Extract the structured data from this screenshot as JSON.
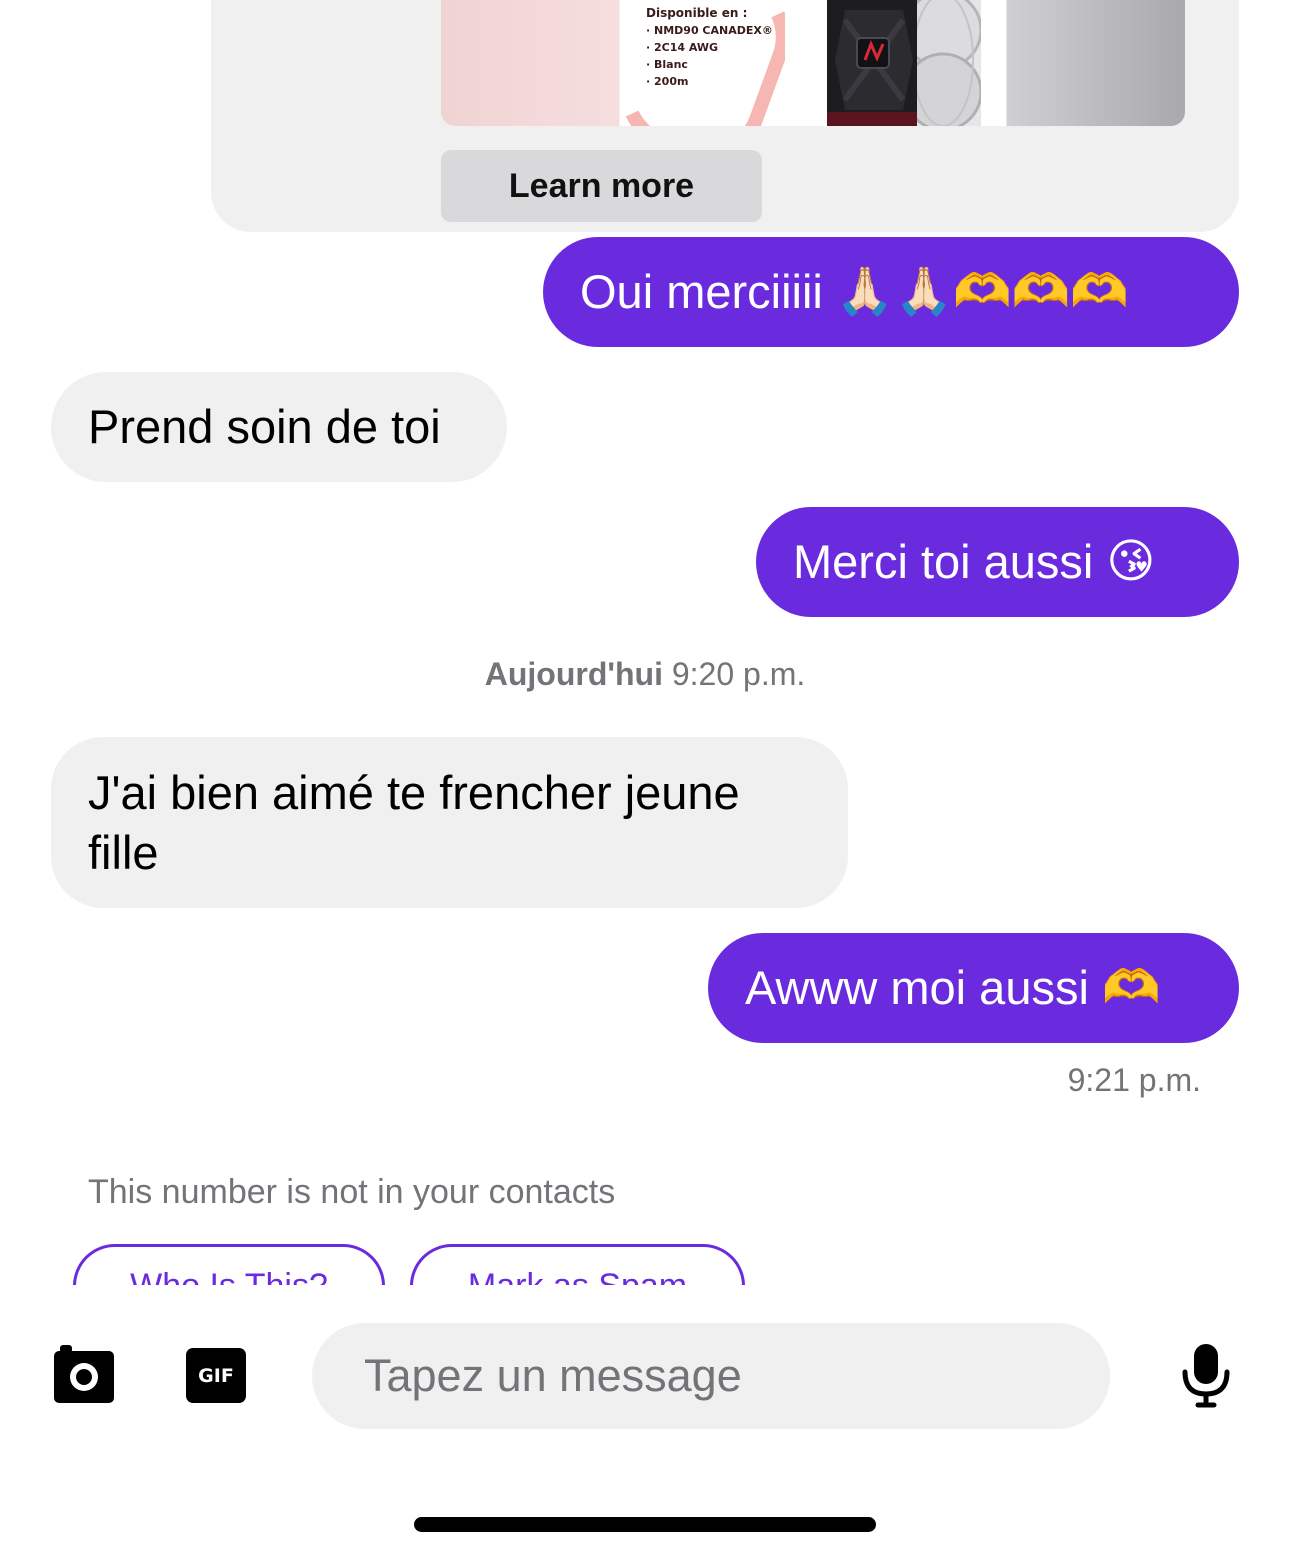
{
  "ad": {
    "image_lines": [
      "Disponible en :",
      "· NMD90 CANADEX®",
      "· 2C14 AWG",
      "· Blanc",
      "· 200m"
    ],
    "learn_more_label": "Learn more"
  },
  "messages": [
    {
      "direction": "sent",
      "text": "Oui merciiiii",
      "emoji": "🙏🏻🙏🏻🫶🫶🫶"
    },
    {
      "direction": "received",
      "text": "Prend soin de toi",
      "emoji": ""
    },
    {
      "direction": "sent",
      "text": "Merci toi aussi",
      "emoji": "😘"
    },
    {
      "direction": "received",
      "text": "J'ai bien aimé te frencher jeune fille",
      "emoji": ""
    },
    {
      "direction": "sent",
      "text": "Awww moi aussi",
      "emoji": "🫶"
    }
  ],
  "date_divider": {
    "day": "Aujourd'hui",
    "time": "9:20 p.m."
  },
  "last_message_time": "9:21 p.m.",
  "unknown_notice": "This number is not in your contacts",
  "actions": {
    "who_is_this": "Who Is This?",
    "mark_as_spam": "Mark as Spam"
  },
  "composer": {
    "placeholder": "Tapez un message",
    "gif_label": "GIF",
    "camera_icon": "camera-icon",
    "mic_icon": "microphone-icon"
  },
  "colors": {
    "sent_bubble": "#6a2bdf",
    "received_bubble": "#f0f0f0",
    "meta_text": "#737378"
  }
}
